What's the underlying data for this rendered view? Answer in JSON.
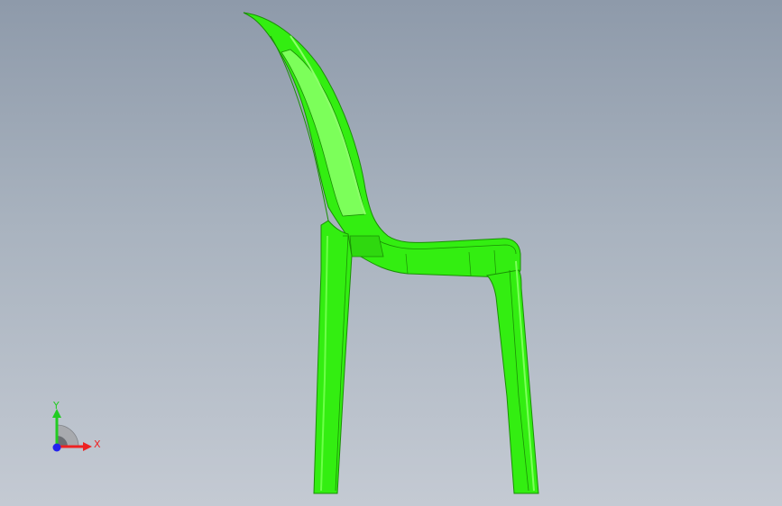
{
  "viewport": {
    "background_top": "#8e9aaa",
    "background_bottom": "#c4cad3"
  },
  "model": {
    "part": "chair",
    "view": "right side",
    "color": "#33ee11",
    "highlight": "#66ff44",
    "shade": "#22bb08",
    "edge": "#1a8f05"
  },
  "triad": {
    "y_label": "Y",
    "x_label": "X",
    "y_color": "#22cc22",
    "x_color": "#ee2222",
    "z_color": "#2222ee"
  }
}
